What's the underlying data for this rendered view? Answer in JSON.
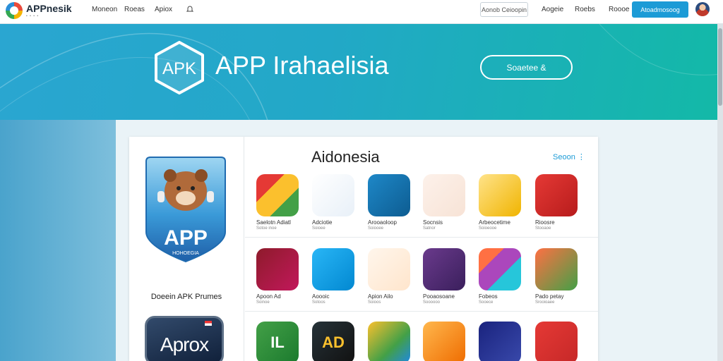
{
  "header": {
    "logo_text": "APPnesik",
    "nav": [
      "Moneon",
      "Roeas",
      "Apiox"
    ],
    "search_label": "Aonob Ceioopin",
    "right_links": [
      "Aogeie",
      "Roebs",
      "Roooe"
    ],
    "cta_label": "Atoadmosoog"
  },
  "hero": {
    "badge_text": "APK",
    "title": "APP Irahaelisia",
    "button_label": "Soaetee &"
  },
  "featured": {
    "badge_title": "APP",
    "badge_sub": "HOHOEGIA",
    "caption": "Doeein APK Prumes",
    "second_badge_text": "Aprox"
  },
  "section": {
    "title": "Aidonesia",
    "see_more": "Seoon ⋮"
  },
  "rows": [
    [
      {
        "name": "Saelotn Adiatl",
        "sub": "Sotoe inoe",
        "icon": "camera-app-icon"
      },
      {
        "name": "Adciotie",
        "sub": "Soioee",
        "icon": "play-triangle-icon"
      },
      {
        "name": "Arooaoloop",
        "sub": "Soiooee",
        "icon": "play-store-icon"
      },
      {
        "name": "Socnsis",
        "sub": "Satnor",
        "icon": "fox-app-icon"
      },
      {
        "name": "Arbeocetime",
        "sub": "Soioeooe",
        "icon": "owl-app-icon"
      },
      {
        "name": "Rioosre",
        "sub": "Stooaoe",
        "icon": "ring-app-icon"
      }
    ],
    [
      {
        "name": "Apoon Ad",
        "sub": "Soinoe",
        "icon": "refresh-app-icon"
      },
      {
        "name": "Aoooic",
        "sub": "Sotoos",
        "icon": "letter-a-icon"
      },
      {
        "name": "Apion Ailo",
        "sub": "Soioos",
        "icon": "cat-app-icon"
      },
      {
        "name": "Pooaosoane",
        "sub": "Soooooo",
        "icon": "grid-app-icon"
      },
      {
        "name": "Fobeos",
        "sub": "Sooece",
        "icon": "bear-app-icon"
      },
      {
        "name": "Pado petay",
        "sub": "Srooioaee",
        "icon": "gallery-app-icon"
      }
    ],
    [
      {
        "name": "",
        "sub": "",
        "icon": "il-app-icon",
        "glyph": "IL"
      },
      {
        "name": "",
        "sub": "",
        "icon": "ad-app-icon",
        "glyph": "AD"
      },
      {
        "name": "",
        "sub": "",
        "icon": "diamond-app-icon",
        "glyph": ""
      },
      {
        "name": "",
        "sub": "",
        "icon": "eye-app-icon",
        "glyph": ""
      },
      {
        "name": "",
        "sub": "",
        "icon": "arrow-app-icon",
        "glyph": ""
      },
      {
        "name": "",
        "sub": "",
        "icon": "pencil-app-icon",
        "glyph": ""
      }
    ]
  ],
  "colors": {
    "accent": "#1c9bd6",
    "hero_start": "#2aa6d1",
    "hero_end": "#13b9a7"
  }
}
